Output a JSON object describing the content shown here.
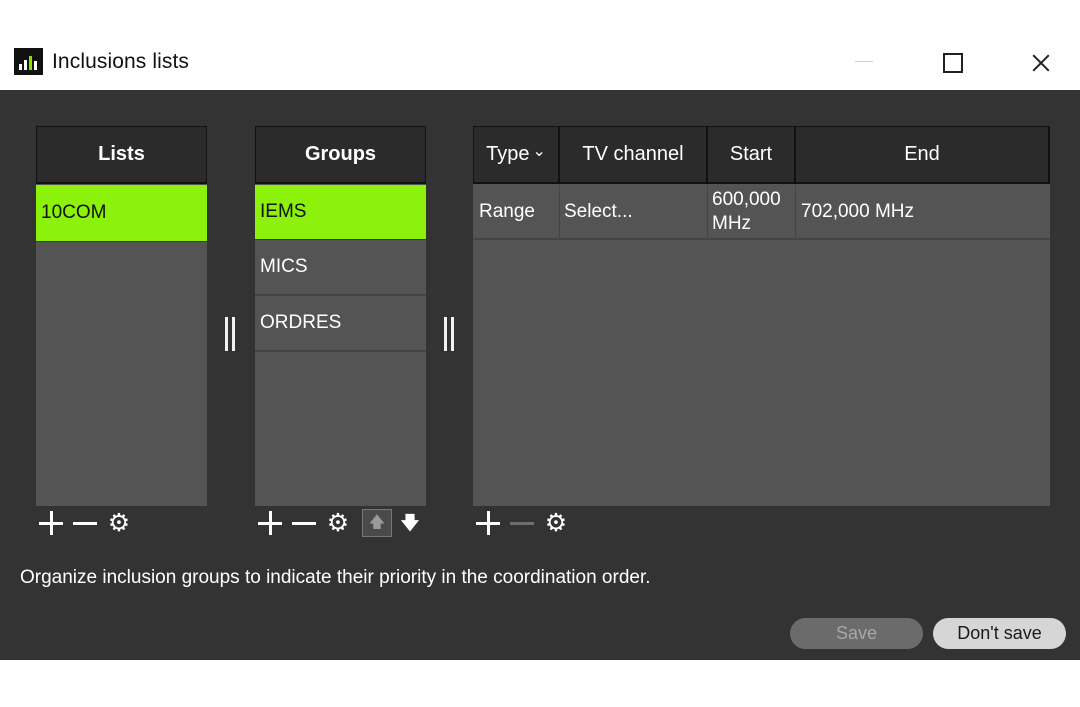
{
  "window": {
    "title": "Inclusions lists"
  },
  "lists": {
    "header": "Lists",
    "items": [
      {
        "label": "10COM",
        "selected": true
      }
    ]
  },
  "groups": {
    "header": "Groups",
    "items": [
      {
        "label": "IEMS",
        "selected": true
      },
      {
        "label": "MICS",
        "selected": false
      },
      {
        "label": "ORDRES",
        "selected": false
      }
    ]
  },
  "ranges": {
    "columns": {
      "type": "Type",
      "tv_channel": "TV channel",
      "start": "Start",
      "end": "End"
    },
    "rows": [
      {
        "type": "Range",
        "tv_channel": "Select...",
        "start_line1": "600,000",
        "start_line2": "MHz",
        "end": "702,000 MHz"
      }
    ]
  },
  "icons": {
    "add": "plus-icon",
    "remove": "minus-icon",
    "settings": "gear-icon",
    "move_up": "arrow-up-icon",
    "move_down": "arrow-down-icon",
    "gear_glyph": "⚙",
    "up_glyph": "🡅",
    "down_glyph": "🡇",
    "type_chevron": "⌄"
  },
  "hint": "Organize inclusion groups to indicate their priority in the coordination order.",
  "buttons": {
    "save": "Save",
    "dont_save": "Don't save"
  },
  "colors": {
    "selection": "#8cf20b",
    "dialog_bg": "#333333",
    "panel_bg": "#545454",
    "header_bg": "#2b2b2b"
  }
}
